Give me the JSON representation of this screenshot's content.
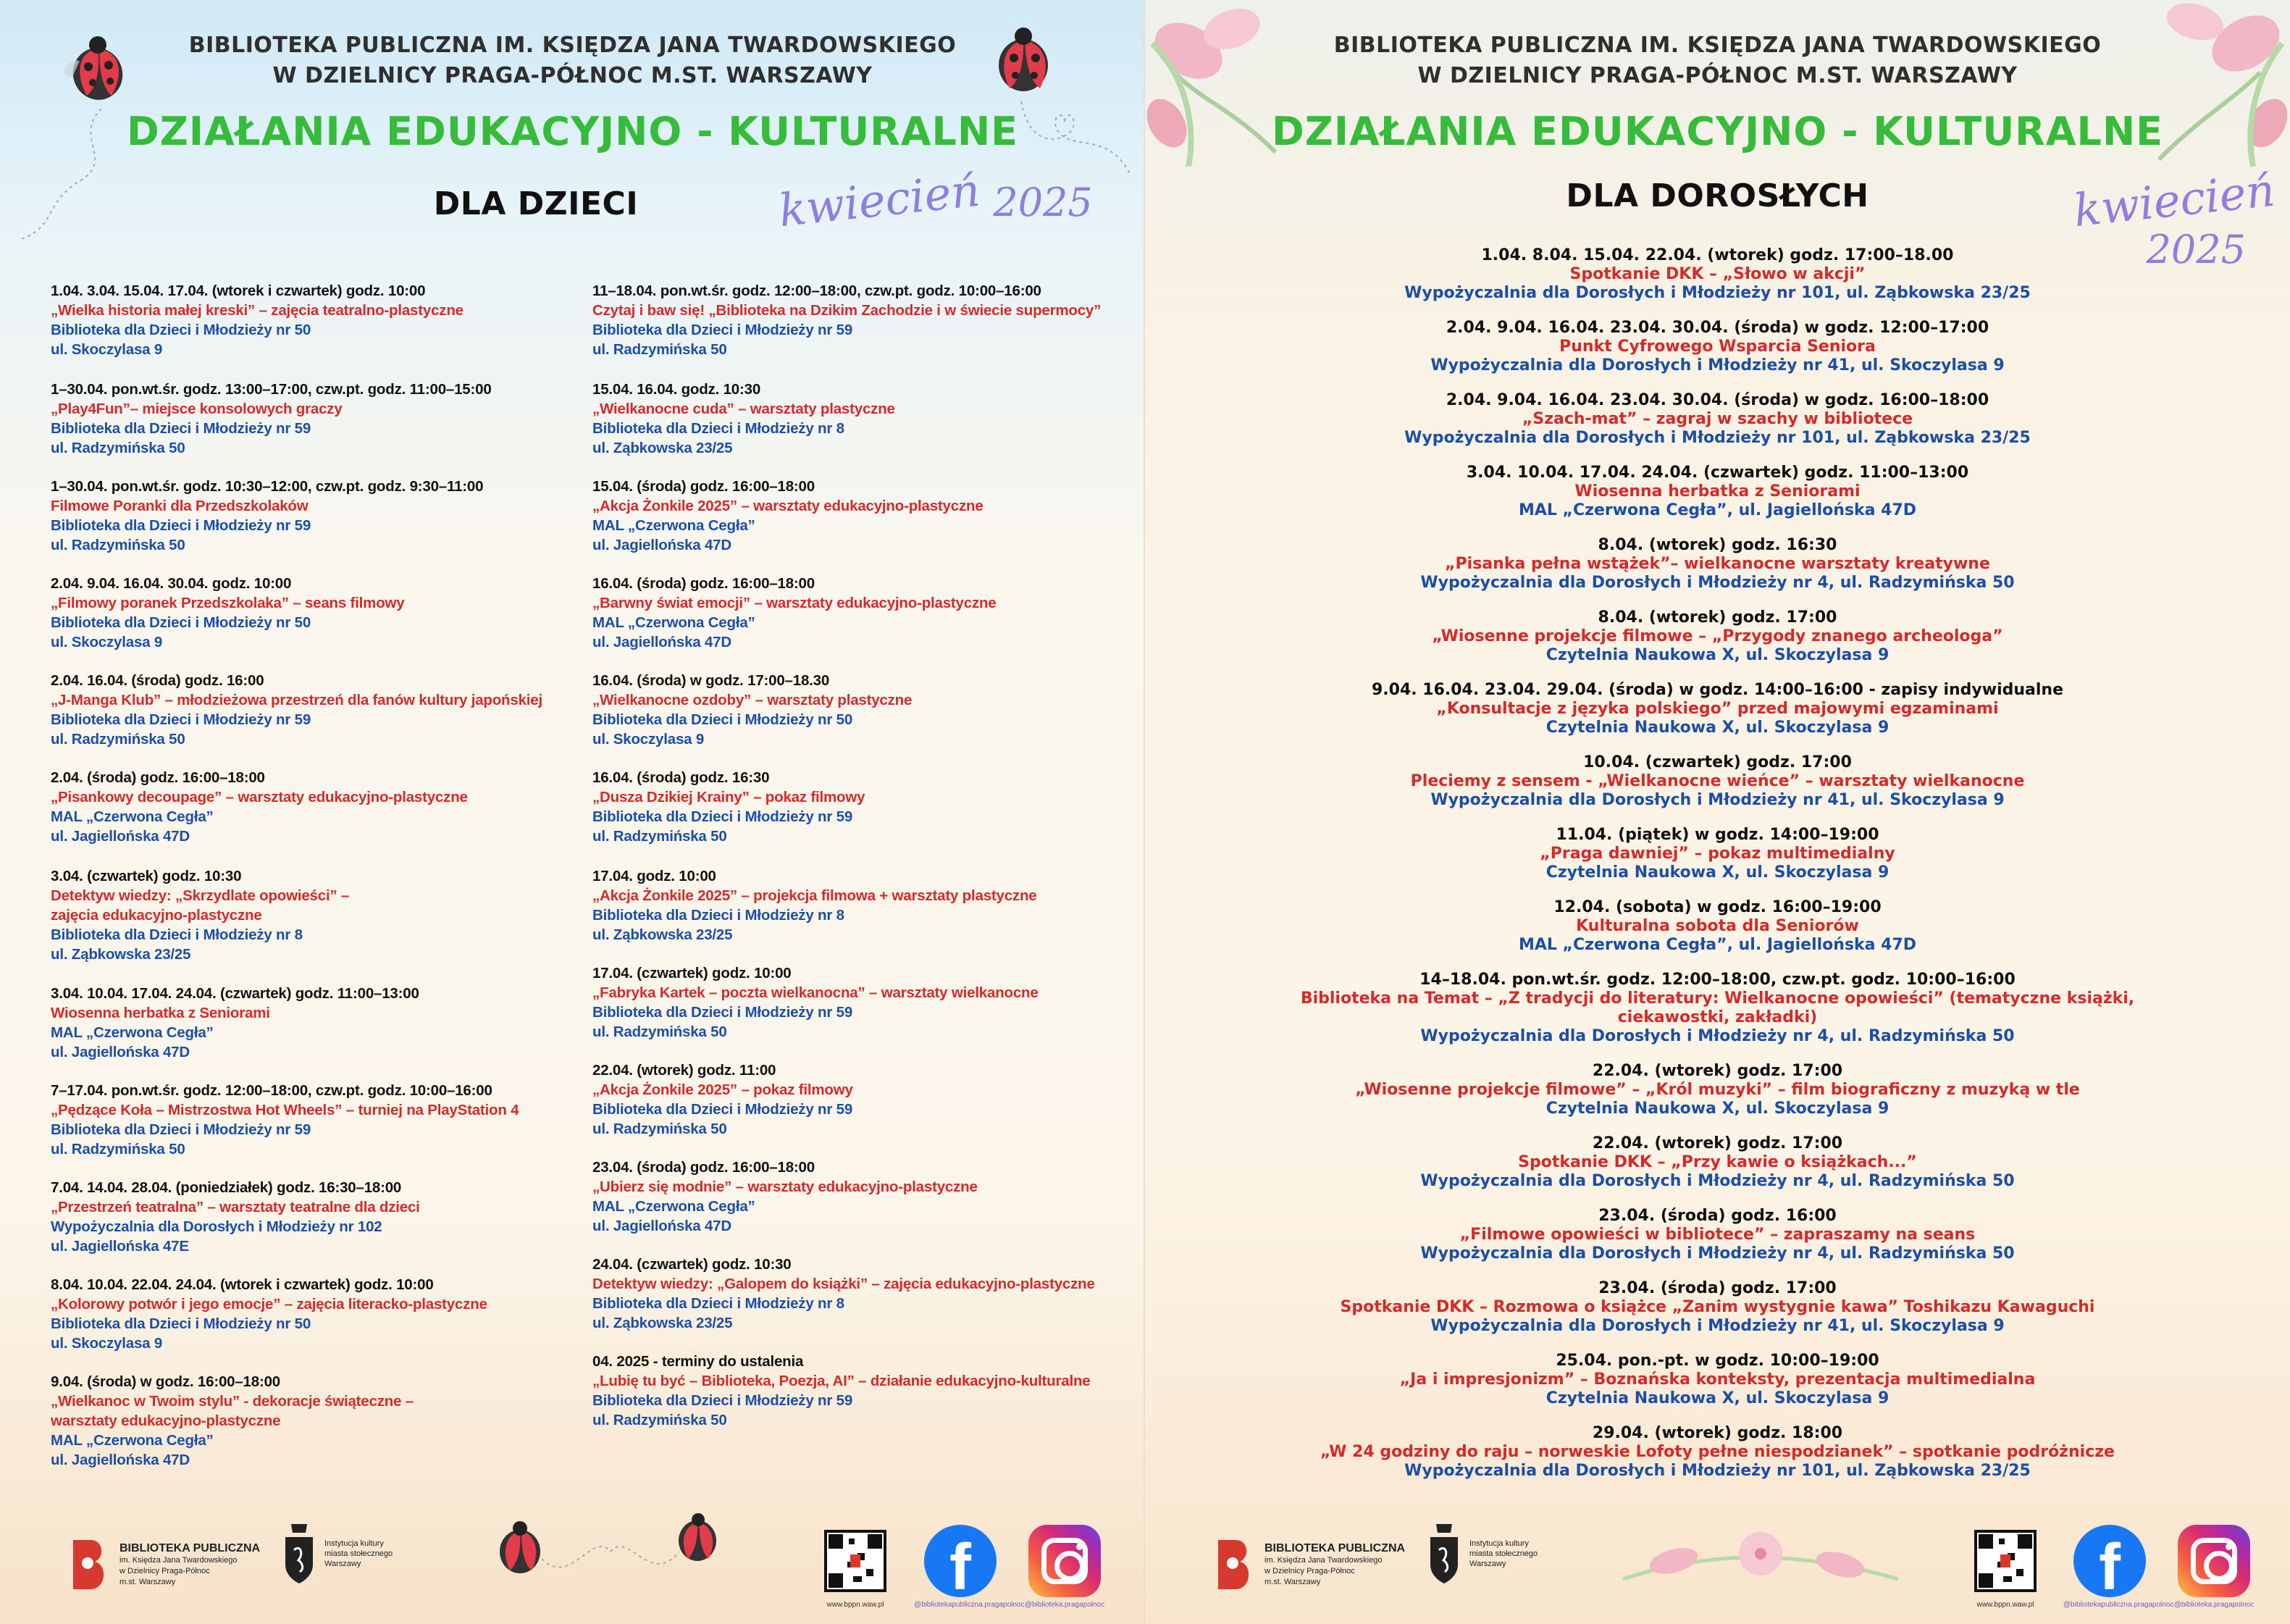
{
  "header": {
    "library_line1": "BIBLIOTEKA PUBLICZNA IM. KSIĘDZA JANA TWARDOWSKIEGO",
    "library_line2": "W DZIELNICY PRAGA-PÓŁNOC M.ST. WARSZAWY",
    "main_title": "DZIAŁANIA EDUKACYJNO - KULTURALNE",
    "month": "kwiecień",
    "year": "2025"
  },
  "kids": {
    "subtitle": "DLA DZIECI",
    "left_events": [
      {
        "date": "1.04.   3.04.   15.04.   17.04.  (wtorek i czwartek)  godz. 10:00",
        "title": "„Wielka historia małej kreski” – zajęcia teatralno-plastyczne",
        "place": "Biblioteka dla Dzieci i Młodzieży nr 50",
        "address": "ul. Skoczylasa 9"
      },
      {
        "date": "1–30.04.  pon.wt.śr.  godz. 13:00–17:00,  czw.pt.  godz. 11:00–15:00",
        "title": "„Play4Fun”– miejsce konsolowych graczy",
        "place": "Biblioteka dla Dzieci i Młodzieży nr 59",
        "address": "ul. Radzymińska 50"
      },
      {
        "date": "1–30.04.  pon.wt.śr.  godz. 10:30–12:00,  czw.pt. godz. 9:30–11:00",
        "title": "Filmowe Poranki dla Przedszkolaków",
        "place": "Biblioteka dla Dzieci i Młodzieży nr 59",
        "address": "ul. Radzymińska 50"
      },
      {
        "date": "2.04.   9.04.   16.04.   30.04.   godz. 10:00",
        "title": "„Filmowy poranek Przedszkolaka” – seans filmowy",
        "place": "Biblioteka dla Dzieci i Młodzieży nr 50",
        "address": "ul. Skoczylasa 9"
      },
      {
        "date": "2.04.  16.04.  (środa)   godz. 16:00",
        "title": "„J-Manga Klub” – młodzieżowa przestrzeń dla fanów kultury japońskiej",
        "place": "Biblioteka dla Dzieci i Młodzieży nr 59",
        "address": "ul. Radzymińska 50"
      },
      {
        "date": "2.04.  (środa)  godz. 16:00–18:00",
        "title": "„Pisankowy decoupage” – warsztaty edukacyjno-plastyczne",
        "place": "MAL „Czerwona Cegła”",
        "address": "ul. Jagiellońska 47D"
      },
      {
        "date": "3.04.  (czwartek)  godz. 10:30",
        "title": "Detektyw wiedzy: „Skrzydlate opowieści” –",
        "title2": "zajęcia edukacyjno-plastyczne",
        "place": "Biblioteka dla Dzieci i Młodzieży nr 8",
        "address": "ul. Ząbkowska 23/25"
      },
      {
        "date": "3.04.   10.04.   17.04.   24.04.   (czwartek)  godz. 11:00–13:00",
        "title": "Wiosenna herbatka z Seniorami",
        "place": "MAL „Czerwona Cegła”",
        "address": "ul. Jagiellońska 47D"
      },
      {
        "date": "7–17.04.  pon.wt.śr.  godz. 12:00–18:00,  czw.pt.  godz. 10:00–16:00",
        "title": "„Pędzące Koła – Mistrzostwa Hot Wheels” – turniej na PlayStation 4",
        "place": "Biblioteka dla Dzieci i Młodzieży nr 59",
        "address": "ul. Radzymińska 50"
      },
      {
        "date": "7.04.  14.04.  28.04.  (poniedziałek)  godz. 16:30–18:00",
        "title": "„Przestrzeń teatralna” – warsztaty teatralne dla dzieci",
        "place": "Wypożyczalnia dla Dorosłych i Młodzieży nr 102",
        "address": "ul. Jagiellońska 47E"
      },
      {
        "date": "8.04.   10.04.   22.04.   24.04.   (wtorek i czwartek)  godz. 10:00",
        "title": "„Kolorowy potwór i jego emocje” – zajęcia literacko-plastyczne",
        "place": "Biblioteka dla Dzieci i Młodzieży nr 50",
        "address": "ul. Skoczylasa 9"
      },
      {
        "date": "9.04.  (środa)  w godz. 16:00–18:00",
        "title": "„Wielkanoc w Twoim stylu” - dekoracje świąteczne –",
        "title2": "warsztaty edukacyjno-plastyczne",
        "place": "MAL „Czerwona Cegła”",
        "address": "ul. Jagiellońska 47D"
      }
    ],
    "right_events": [
      {
        "date": "11–18.04. pon.wt.śr. godz. 12:00–18:00, czw.pt. godz. 10:00–16:00",
        "title": "Czytaj i baw się! „Biblioteka na Dzikim Zachodzie i w świecie supermocy”",
        "place": "Biblioteka dla Dzieci i Młodzieży nr 59",
        "address": "ul. Radzymińska 50"
      },
      {
        "date": "15.04.  16.04.  godz. 10:30",
        "title": "„Wielkanocne cuda” – warsztaty plastyczne",
        "place": "Biblioteka dla Dzieci i Młodzieży nr 8",
        "address": "ul. Ząbkowska 23/25"
      },
      {
        "date": "15.04.  (środa)   godz. 16:00–18:00",
        "title": "„Akcja Żonkile 2025” – warsztaty edukacyjno-plastyczne",
        "place": "MAL „Czerwona Cegła”",
        "address": "ul. Jagiellońska 47D"
      },
      {
        "date": "16.04.  (środa)   godz. 16:00–18:00",
        "title": "„Barwny świat emocji” – warsztaty edukacyjno-plastyczne",
        "place": "MAL „Czerwona Cegła”",
        "address": "ul. Jagiellońska 47D"
      },
      {
        "date": "16.04. (środa)  w godz. 17:00–18.30",
        "title": "„Wielkanocne ozdoby” – warsztaty plastyczne",
        "place": "Biblioteka dla Dzieci i Młodzieży nr 50",
        "address": "ul. Skoczylasa 9"
      },
      {
        "date": "16.04.  (środa)  godz. 16:30",
        "title": "„Dusza Dzikiej Krainy” – pokaz filmowy",
        "place": "Biblioteka dla Dzieci i Młodzieży nr 59",
        "address": "ul. Radzymińska 50"
      },
      {
        "date": "17.04.  godz. 10:00",
        "title": "„Akcja Żonkile 2025” – projekcja filmowa + warsztaty plastyczne",
        "place": "Biblioteka dla Dzieci i Młodzieży nr 8",
        "address": "ul. Ząbkowska 23/25"
      },
      {
        "date": "17.04.  (czwartek)  godz. 10:00",
        "title": "„Fabryka Kartek – poczta wielkanocna” – warsztaty wielkanocne",
        "place": "Biblioteka dla Dzieci i Młodzieży nr 59",
        "address": "ul. Radzymińska 50"
      },
      {
        "date": "22.04.  (wtorek)  godz. 11:00",
        "title": "„Akcja Żonkile 2025” – pokaz filmowy",
        "place": "Biblioteka dla Dzieci i Młodzieży nr 59",
        "address": "ul. Radzymińska 50"
      },
      {
        "date": "23.04.  (środa)  godz. 16:00–18:00",
        "title": "„Ubierz się modnie” – warsztaty edukacyjno-plastyczne",
        "place": "MAL „Czerwona Cegła”",
        "address": "ul. Jagiellońska 47D"
      },
      {
        "date": "24.04.  (czwartek)  godz. 10:30",
        "title": "Detektyw wiedzy: „Galopem do książki” – zajęcia edukacyjno-plastyczne",
        "place": "Biblioteka dla Dzieci i Młodzieży nr 8",
        "address": "ul. Ząbkowska 23/25"
      },
      {
        "date": "04. 2025 - terminy do ustalenia",
        "title": "„Lubię tu być – Biblioteka, Poezja, AI” – działanie edukacyjno-kulturalne",
        "place": "Biblioteka dla Dzieci i Młodzieży nr 59",
        "address": "ul. Radzymińska 50"
      }
    ]
  },
  "adults": {
    "subtitle": "DLA DOROSŁYCH",
    "events": [
      {
        "date": "1.04. 8.04. 15.04. 22.04. (wtorek) godz. 17:00–18.00",
        "title": "Spotkanie DKK – „Słowo w akcji”",
        "place": "Wypożyczalnia dla Dorosłych i Młodzieży nr 101, ul. Ząbkowska 23/25"
      },
      {
        "date": "2.04. 9.04. 16.04. 23.04. 30.04. (środa) w godz. 12:00–17:00",
        "title": "Punkt Cyfrowego Wsparcia Seniora",
        "place": "Wypożyczalnia dla Dorosłych i Młodzieży nr 41, ul. Skoczylasa 9"
      },
      {
        "date": "2.04. 9.04. 16.04. 23.04. 30.04. (środa) w godz. 16:00–18:00",
        "title": "„Szach-mat” – zagraj w szachy w bibliotece",
        "place": "Wypożyczalnia dla Dorosłych i Młodzieży nr 101, ul. Ząbkowska 23/25"
      },
      {
        "date": "3.04. 10.04. 17.04. 24.04. (czwartek) godz. 11:00–13:00",
        "title": "Wiosenna herbatka z Seniorami",
        "place": "MAL „Czerwona Cegła”, ul. Jagiellońska 47D"
      },
      {
        "date": "8.04. (wtorek) godz. 16:30",
        "title": "„Pisanka pełna wstążek”– wielkanocne warsztaty kreatywne",
        "place": "Wypożyczalnia dla Dorosłych i Młodzieży nr 4, ul. Radzymińska 50"
      },
      {
        "date": "8.04. (wtorek) godz. 17:00",
        "title": "„Wiosenne projekcje filmowe – „Przygody znanego archeologa”",
        "place": "Czytelnia Naukowa X, ul. Skoczylasa 9"
      },
      {
        "date": "9.04. 16.04. 23.04. 29.04. (środa) w godz. 14:00–16:00 - zapisy indywidualne",
        "title": "„Konsultacje z języka polskiego” przed majowymi egzaminami",
        "place": "Czytelnia Naukowa X, ul. Skoczylasa 9"
      },
      {
        "date": "10.04. (czwartek) godz. 17:00",
        "title": "Pleciemy z sensem - „Wielkanocne wieńce” – warsztaty wielkanocne",
        "place": "Wypożyczalnia dla Dorosłych i Młodzieży nr 41, ul. Skoczylasa 9"
      },
      {
        "date": "11.04. (piątek) w godz. 14:00–19:00",
        "title": "„Praga dawniej” – pokaz multimedialny",
        "place": "Czytelnia Naukowa X, ul. Skoczylasa 9"
      },
      {
        "date": "12.04. (sobota) w godz. 16:00–19:00",
        "title": "Kulturalna sobota dla Seniorów",
        "place": "MAL „Czerwona Cegła”, ul. Jagiellońska 47D"
      },
      {
        "date": "14–18.04. pon.wt.śr. godz. 12:00–18:00, czw.pt. godz. 10:00–16:00",
        "title": "Biblioteka na Temat – „Z tradycji do literatury: Wielkanocne opowieści” (tematyczne książki, ciekawostki, zakładki)",
        "place": "Wypożyczalnia dla Dorosłych i Młodzieży nr 4, ul. Radzymińska 50"
      },
      {
        "date": "22.04. (wtorek) godz. 17:00",
        "title": "„Wiosenne projekcje filmowe” – „Król muzyki” – film biograficzny z muzyką w tle",
        "place": "Czytelnia Naukowa X, ul. Skoczylasa 9"
      },
      {
        "date": "22.04. (wtorek) godz. 17:00",
        "title": "Spotkanie DKK – „Przy kawie o książkach...”",
        "place": "Wypożyczalnia dla Dorosłych i Młodzieży nr 4, ul. Radzymińska 50"
      },
      {
        "date": "23.04. (środa) godz. 16:00",
        "title": "„Filmowe opowieści w bibliotece” – zapraszamy na seans",
        "place": "Wypożyczalnia dla Dorosłych i Młodzieży nr 4, ul. Radzymińska 50"
      },
      {
        "date": "23.04. (środa) godz. 17:00",
        "title": "Spotkanie DKK – Rozmowa o książce „Zanim wystygnie kawa” Toshikazu Kawaguchi",
        "place": "Wypożyczalnia dla Dorosłych i Młodzieży nr 41, ul. Skoczylasa 9"
      },
      {
        "date": "25.04. pon.-pt. w godz. 10:00–19:00",
        "title": "„Ja i impresjonizm” – Boznańska konteksty, prezentacja multimedialna",
        "place": "Czytelnia Naukowa X, ul. Skoczylasa 9"
      },
      {
        "date": "29.04. (wtorek) godz. 18:00",
        "title": "„W 24 godziny do raju – norweskie Lofoty pełne niespodzianek” – spotkanie podróżnicze",
        "place": "Wypożyczalnia dla Dorosłych i Młodzieży nr 101, ul. Ząbkowska 23/25"
      }
    ]
  },
  "footer": {
    "logo_line1": "BIBLIOTEKA PUBLICZNA",
    "logo_line2": "im. Księdza Jana Twardowskiego",
    "logo_line3": "w Dzielnicy Praga-Północ",
    "logo_line4": "m.st. Warszawy",
    "institution": "Instytucja kultury miasta stołecznego Warszawy",
    "qr_caption": "www.bppn.waw.pl",
    "facebook_caption": "@bibliotekapubliczna.pragapolnoc",
    "instagram_caption": "@biblioteka.pragapolnoc"
  },
  "colors": {
    "green_title": "#36bc3a",
    "red_text": "#d42a2a",
    "blue_text": "#1c4ea6",
    "month": "#8d7fdd"
  },
  "icons": [
    "ladybug-icon",
    "tulip-icon",
    "qr-code-icon",
    "facebook-icon",
    "instagram-icon",
    "warsaw-crest-icon"
  ]
}
